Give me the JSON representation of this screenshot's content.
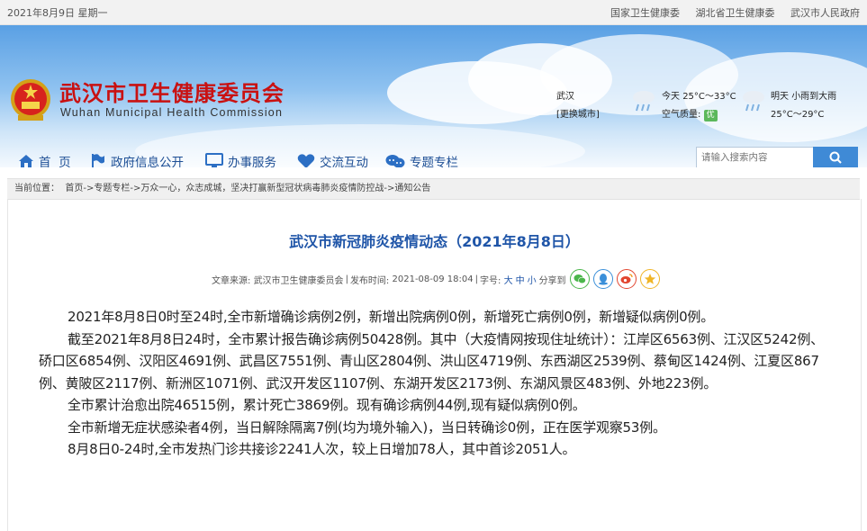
{
  "topbar": {
    "date": "2021年8月9日 星期一",
    "links": [
      "国家卫生健康委",
      "湖北省卫生健康委",
      "武汉市人民政府"
    ]
  },
  "header": {
    "title": "武汉市卫生健康委员会",
    "subtitle": "Wuhan Municipal Health Commission",
    "title_color": "#c91111"
  },
  "weather": {
    "city": "武汉",
    "change_city": "[更换城市]",
    "today_label": "今天",
    "today_temp": "25°C～33°C",
    "aqi_label": "空气质量:",
    "aqi_value": "优",
    "tomorrow_label": "明天",
    "tomorrow_desc": "小雨到大雨",
    "tomorrow_temp": "25°C～29°C"
  },
  "nav": {
    "items": [
      {
        "label": "首  页",
        "icon": "home-icon"
      },
      {
        "label": "政府信息公开",
        "icon": "flag-icon"
      },
      {
        "label": "办事服务",
        "icon": "monitor-icon"
      },
      {
        "label": "交流互动",
        "icon": "heart-icon"
      },
      {
        "label": "专题专栏",
        "icon": "chat-icon"
      }
    ],
    "color": "#1e4f95"
  },
  "search": {
    "placeholder": "请输入搜索内容",
    "icon": "search-icon"
  },
  "breadcrumb": {
    "text": "当前位置：  首页->专题专栏->万众一心，众志成城，坚决打赢新型冠状病毒肺炎疫情防控战->通知公告"
  },
  "article": {
    "title": "武汉市新冠肺炎疫情动态（2021年8月8日）",
    "meta": {
      "source_label": "文章来源:",
      "source": "武汉市卫生健康委员会",
      "time_label": "发布时间:",
      "time": "2021-08-09 18:04",
      "size_label": "字号:",
      "sizes": [
        "大",
        "中",
        "小"
      ],
      "share_label": "分享到",
      "share_icons": [
        "wechat-icon",
        "qq-icon",
        "weibo-icon",
        "qzone-icon"
      ]
    },
    "paragraphs": [
      "2021年8月8日0时至24时,全市新增确诊病例2例，新增出院病例0例，新增死亡病例0例，新增疑似病例0例。",
      "截至2021年8月8日24时，全市累计报告确诊病例50428例。其中（大疫情网按现住址统计）：江岸区6563例、江汉区5242例、硚口区6854例、汉阳区4691例、武昌区7551例、青山区2804例、洪山区4719例、东西湖区2539例、蔡甸区1424例、江夏区867例、黄陂区2117例、新洲区1071例、武汉开发区1107例、东湖开发区2173例、东湖风景区483例、外地223例。",
      "全市累计治愈出院46515例，累计死亡3869例。现有确诊病例44例,现有疑似病例0例。",
      "全市新增无症状感染者4例，当日解除隔离7例(均为境外输入)，当日转确诊0例，正在医学观察53例。",
      "8月8日0-24时,全市发热门诊共接诊2241人次，较上日增加78人，其中首诊2051人。"
    ]
  }
}
